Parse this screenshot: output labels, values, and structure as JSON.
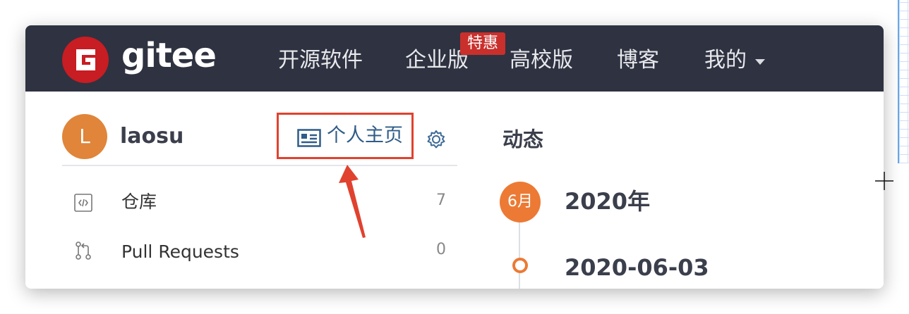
{
  "header": {
    "brand": "gitee",
    "nav": [
      "开源软件",
      "企业版",
      "高校版",
      "博客",
      "我的"
    ],
    "badge": "特惠"
  },
  "sidebar": {
    "avatar_letter": "L",
    "username": "laosu",
    "profile_link": "个人主页",
    "menu": [
      {
        "label": "仓库",
        "count": "7"
      },
      {
        "label": "Pull Requests",
        "count": "0"
      }
    ]
  },
  "feed": {
    "title": "动态",
    "month_badge": "6月",
    "year": "2020年",
    "date": "2020-06-03"
  },
  "colors": {
    "topbar": "#2f3241",
    "brand_red": "#c9302c",
    "accent_orange": "#ec7a34",
    "highlight_box": "#e0422f",
    "link_blue": "#2f5c88"
  }
}
